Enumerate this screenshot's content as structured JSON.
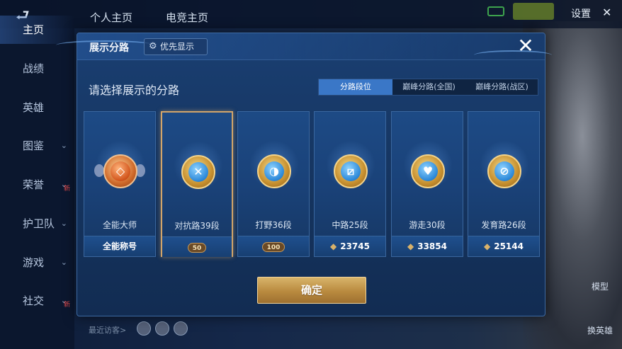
{
  "topbar": {
    "tabs": [
      "个人主页",
      "电竞主页"
    ],
    "settings_label": "设置",
    "close_glyph": "✕",
    "back_glyph": "⮐"
  },
  "sidebar": {
    "items": [
      {
        "label": "主页",
        "active": true,
        "chevron": false,
        "new": false
      },
      {
        "label": "战绩",
        "active": false,
        "chevron": false,
        "new": false
      },
      {
        "label": "英雄",
        "active": false,
        "chevron": false,
        "new": false
      },
      {
        "label": "图鉴",
        "active": false,
        "chevron": true,
        "new": false
      },
      {
        "label": "荣誉",
        "active": false,
        "chevron": true,
        "new": true
      },
      {
        "label": "护卫队",
        "active": false,
        "chevron": true,
        "new": false
      },
      {
        "label": "游戏",
        "active": false,
        "chevron": true,
        "new": false
      },
      {
        "label": "社交",
        "active": false,
        "chevron": true,
        "new": true
      }
    ],
    "new_label": "新",
    "chevron_glyph": "⌄"
  },
  "bottom": {
    "visitors_label": "最近访客>",
    "model_label": "模型",
    "change_hero_label": "换英雄"
  },
  "modal": {
    "title": "展示分路",
    "priority_label": "优先显示",
    "close_glyph": "✕",
    "subtitle": "请选择展示的分路",
    "tabs": [
      {
        "label": "分路段位",
        "active": true
      },
      {
        "label": "巅峰分路(全国)",
        "active": false
      },
      {
        "label": "巅峰分路(战区)",
        "active": false
      }
    ],
    "cards": [
      {
        "label": "全能大师",
        "footer": "全能称号",
        "footer_type": "text",
        "emblem": "master",
        "glyph": "◇",
        "selected": false
      },
      {
        "label": "对抗路39段",
        "footer": "50",
        "footer_type": "badge",
        "emblem": "gold",
        "glyph": "✕",
        "selected": true
      },
      {
        "label": "打野36段",
        "footer": "100",
        "footer_type": "badge",
        "emblem": "gold",
        "glyph": "◑",
        "selected": false
      },
      {
        "label": "中路25段",
        "footer": "23745",
        "footer_type": "score",
        "emblem": "gold",
        "glyph": "⧄",
        "selected": false
      },
      {
        "label": "游走30段",
        "footer": "33854",
        "footer_type": "score",
        "emblem": "gold",
        "glyph": "♥",
        "selected": false
      },
      {
        "label": "发育路26段",
        "footer": "25144",
        "footer_type": "score",
        "emblem": "gold",
        "glyph": "⊘",
        "selected": false
      }
    ],
    "confirm_label": "确定"
  },
  "colors": {
    "accent_blue": "#3a77c7",
    "gold": "#d2a56a",
    "modal_bg": "#15345f"
  }
}
